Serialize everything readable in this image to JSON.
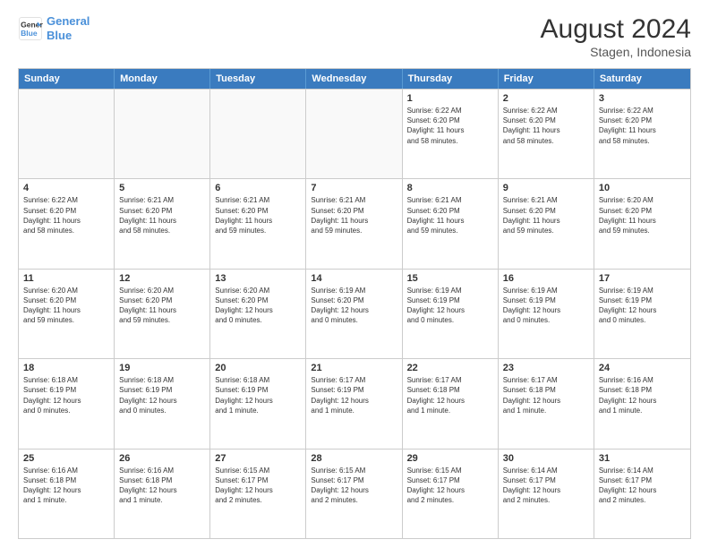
{
  "logo": {
    "line1": "General",
    "line2": "Blue"
  },
  "title": "August 2024",
  "location": "Stagen, Indonesia",
  "days": [
    "Sunday",
    "Monday",
    "Tuesday",
    "Wednesday",
    "Thursday",
    "Friday",
    "Saturday"
  ],
  "weeks": [
    [
      {
        "day": "",
        "info": "",
        "empty": true
      },
      {
        "day": "",
        "info": "",
        "empty": true
      },
      {
        "day": "",
        "info": "",
        "empty": true
      },
      {
        "day": "",
        "info": "",
        "empty": true
      },
      {
        "day": "1",
        "info": "Sunrise: 6:22 AM\nSunset: 6:20 PM\nDaylight: 11 hours\nand 58 minutes."
      },
      {
        "day": "2",
        "info": "Sunrise: 6:22 AM\nSunset: 6:20 PM\nDaylight: 11 hours\nand 58 minutes."
      },
      {
        "day": "3",
        "info": "Sunrise: 6:22 AM\nSunset: 6:20 PM\nDaylight: 11 hours\nand 58 minutes."
      }
    ],
    [
      {
        "day": "4",
        "info": "Sunrise: 6:22 AM\nSunset: 6:20 PM\nDaylight: 11 hours\nand 58 minutes."
      },
      {
        "day": "5",
        "info": "Sunrise: 6:21 AM\nSunset: 6:20 PM\nDaylight: 11 hours\nand 58 minutes."
      },
      {
        "day": "6",
        "info": "Sunrise: 6:21 AM\nSunset: 6:20 PM\nDaylight: 11 hours\nand 59 minutes."
      },
      {
        "day": "7",
        "info": "Sunrise: 6:21 AM\nSunset: 6:20 PM\nDaylight: 11 hours\nand 59 minutes."
      },
      {
        "day": "8",
        "info": "Sunrise: 6:21 AM\nSunset: 6:20 PM\nDaylight: 11 hours\nand 59 minutes."
      },
      {
        "day": "9",
        "info": "Sunrise: 6:21 AM\nSunset: 6:20 PM\nDaylight: 11 hours\nand 59 minutes."
      },
      {
        "day": "10",
        "info": "Sunrise: 6:20 AM\nSunset: 6:20 PM\nDaylight: 11 hours\nand 59 minutes."
      }
    ],
    [
      {
        "day": "11",
        "info": "Sunrise: 6:20 AM\nSunset: 6:20 PM\nDaylight: 11 hours\nand 59 minutes."
      },
      {
        "day": "12",
        "info": "Sunrise: 6:20 AM\nSunset: 6:20 PM\nDaylight: 11 hours\nand 59 minutes."
      },
      {
        "day": "13",
        "info": "Sunrise: 6:20 AM\nSunset: 6:20 PM\nDaylight: 12 hours\nand 0 minutes."
      },
      {
        "day": "14",
        "info": "Sunrise: 6:19 AM\nSunset: 6:20 PM\nDaylight: 12 hours\nand 0 minutes."
      },
      {
        "day": "15",
        "info": "Sunrise: 6:19 AM\nSunset: 6:19 PM\nDaylight: 12 hours\nand 0 minutes."
      },
      {
        "day": "16",
        "info": "Sunrise: 6:19 AM\nSunset: 6:19 PM\nDaylight: 12 hours\nand 0 minutes."
      },
      {
        "day": "17",
        "info": "Sunrise: 6:19 AM\nSunset: 6:19 PM\nDaylight: 12 hours\nand 0 minutes."
      }
    ],
    [
      {
        "day": "18",
        "info": "Sunrise: 6:18 AM\nSunset: 6:19 PM\nDaylight: 12 hours\nand 0 minutes."
      },
      {
        "day": "19",
        "info": "Sunrise: 6:18 AM\nSunset: 6:19 PM\nDaylight: 12 hours\nand 0 minutes."
      },
      {
        "day": "20",
        "info": "Sunrise: 6:18 AM\nSunset: 6:19 PM\nDaylight: 12 hours\nand 1 minute."
      },
      {
        "day": "21",
        "info": "Sunrise: 6:17 AM\nSunset: 6:19 PM\nDaylight: 12 hours\nand 1 minute."
      },
      {
        "day": "22",
        "info": "Sunrise: 6:17 AM\nSunset: 6:18 PM\nDaylight: 12 hours\nand 1 minute."
      },
      {
        "day": "23",
        "info": "Sunrise: 6:17 AM\nSunset: 6:18 PM\nDaylight: 12 hours\nand 1 minute."
      },
      {
        "day": "24",
        "info": "Sunrise: 6:16 AM\nSunset: 6:18 PM\nDaylight: 12 hours\nand 1 minute."
      }
    ],
    [
      {
        "day": "25",
        "info": "Sunrise: 6:16 AM\nSunset: 6:18 PM\nDaylight: 12 hours\nand 1 minute."
      },
      {
        "day": "26",
        "info": "Sunrise: 6:16 AM\nSunset: 6:18 PM\nDaylight: 12 hours\nand 1 minute."
      },
      {
        "day": "27",
        "info": "Sunrise: 6:15 AM\nSunset: 6:17 PM\nDaylight: 12 hours\nand 2 minutes."
      },
      {
        "day": "28",
        "info": "Sunrise: 6:15 AM\nSunset: 6:17 PM\nDaylight: 12 hours\nand 2 minutes."
      },
      {
        "day": "29",
        "info": "Sunrise: 6:15 AM\nSunset: 6:17 PM\nDaylight: 12 hours\nand 2 minutes."
      },
      {
        "day": "30",
        "info": "Sunrise: 6:14 AM\nSunset: 6:17 PM\nDaylight: 12 hours\nand 2 minutes."
      },
      {
        "day": "31",
        "info": "Sunrise: 6:14 AM\nSunset: 6:17 PM\nDaylight: 12 hours\nand 2 minutes."
      }
    ]
  ]
}
